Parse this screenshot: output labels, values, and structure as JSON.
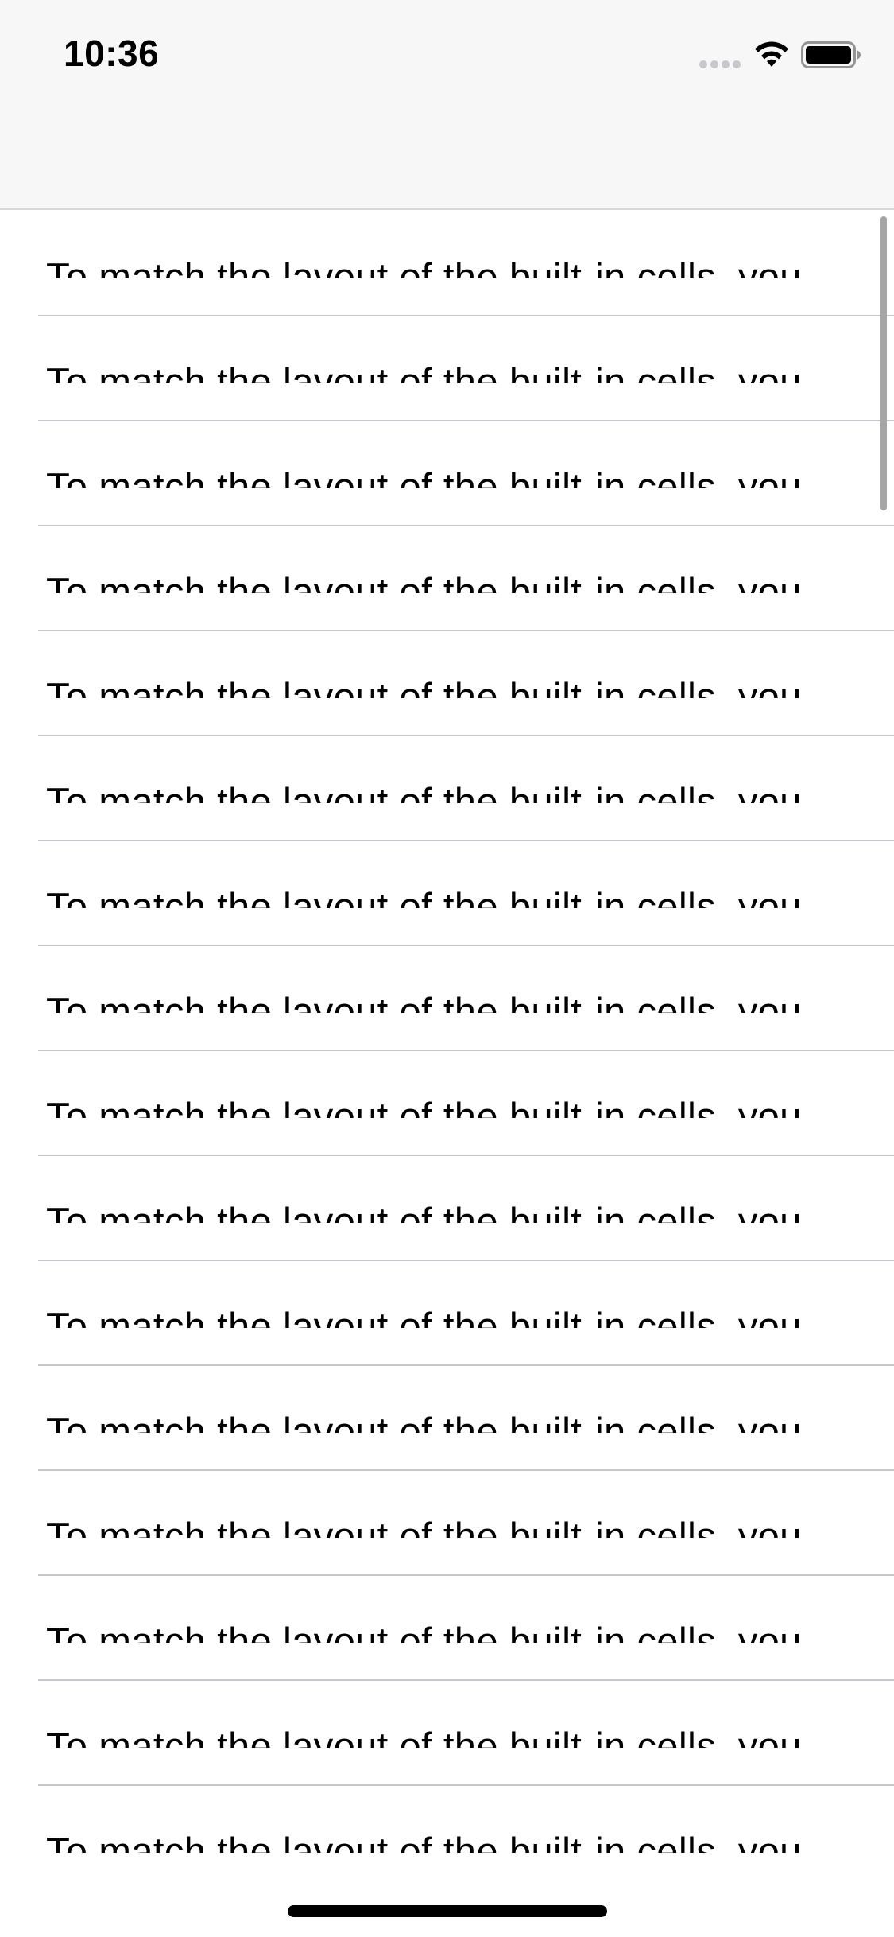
{
  "status_bar": {
    "time": "10:36",
    "signal_icon": "cellular-signal-icon",
    "wifi_icon": "wifi-icon",
    "battery_icon": "battery-icon"
  },
  "nav_bar": {
    "title": ""
  },
  "table": {
    "rows": [
      "To match the layout of the built-in cells, you",
      "To match the layout of the built-in cells, you",
      "To match the layout of the built-in cells, you",
      "To match the layout of the built-in cells, you",
      "To match the layout of the built-in cells, you",
      "To match the layout of the built-in cells, you",
      "To match the layout of the built-in cells, you",
      "To match the layout of the built-in cells, you",
      "To match the layout of the built-in cells, you",
      "To match the layout of the built-in cells, you",
      "To match the layout of the built-in cells, you",
      "To match the layout of the built-in cells, you",
      "To match the layout of the built-in cells, you",
      "To match the layout of the built-in cells, you",
      "To match the layout of the built-in cells, you",
      "To match the layout of the built-in cells, you"
    ]
  },
  "colors": {
    "bar_background": "#f7f7f7",
    "separator": "#c8c8cc",
    "text": "#000000"
  }
}
